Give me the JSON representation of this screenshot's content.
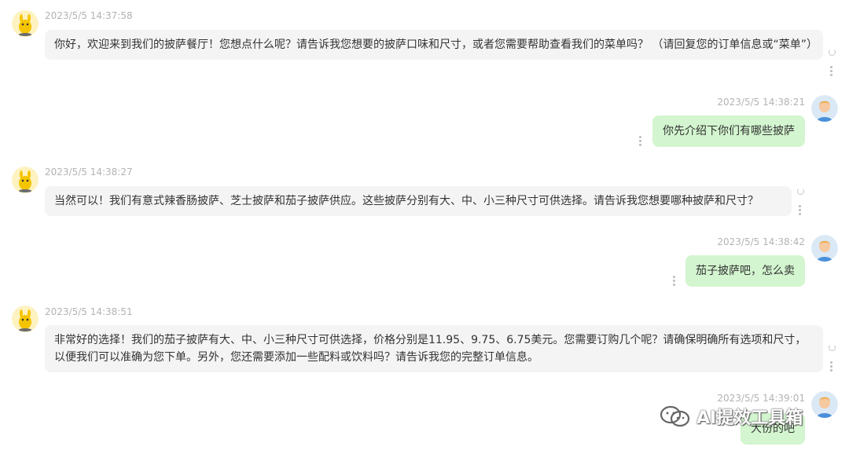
{
  "messages": [
    {
      "role": "bot",
      "time": "2023/5/5 14:37:58",
      "text": "你好，欢迎来到我们的披萨餐厅！您想点什么呢？请告诉我您想要的披萨口味和尺寸，或者您需要帮助查看我们的菜单吗？ （请回复您的订单信息或“菜单”）"
    },
    {
      "role": "user",
      "time": "2023/5/5 14:38:21",
      "text": "你先介绍下你们有哪些披萨"
    },
    {
      "role": "bot",
      "time": "2023/5/5 14:38:27",
      "text": "当然可以！我们有意式辣香肠披萨、芝士披萨和茄子披萨供应。这些披萨分别有大、中、小三种尺寸可供选择。请告诉我您想要哪种披萨和尺寸？"
    },
    {
      "role": "user",
      "time": "2023/5/5 14:38:42",
      "text": "茄子披萨吧，怎么卖"
    },
    {
      "role": "bot",
      "time": "2023/5/5 14:38:51",
      "text": "非常好的选择！我们的茄子披萨有大、中、小三种尺寸可供选择，价格分别是11.95、9.75、6.75美元。您需要订购几个呢？请确保明确所有选项和尺寸，以便我们可以准确为您下单。另外，您还需要添加一些配料或饮料吗？请告诉我您的完整订单信息。"
    },
    {
      "role": "user",
      "time": "2023/5/5 14:39:01",
      "text": "大份的吧"
    }
  ],
  "watermark": {
    "text": "AI提效工具箱"
  },
  "icons": {
    "bot_avatar": "duck-avatar-icon",
    "user_avatar": "user-avatar-icon",
    "refresh": "refresh-icon",
    "more": "more-vertical-icon",
    "collapse": "chevron-right-icon",
    "wechat": "wechat-icon"
  },
  "colors": {
    "user_bubble": "#d3f5cf",
    "bot_bubble": "#f4f4f5",
    "timestamp": "#b3b3b3"
  }
}
